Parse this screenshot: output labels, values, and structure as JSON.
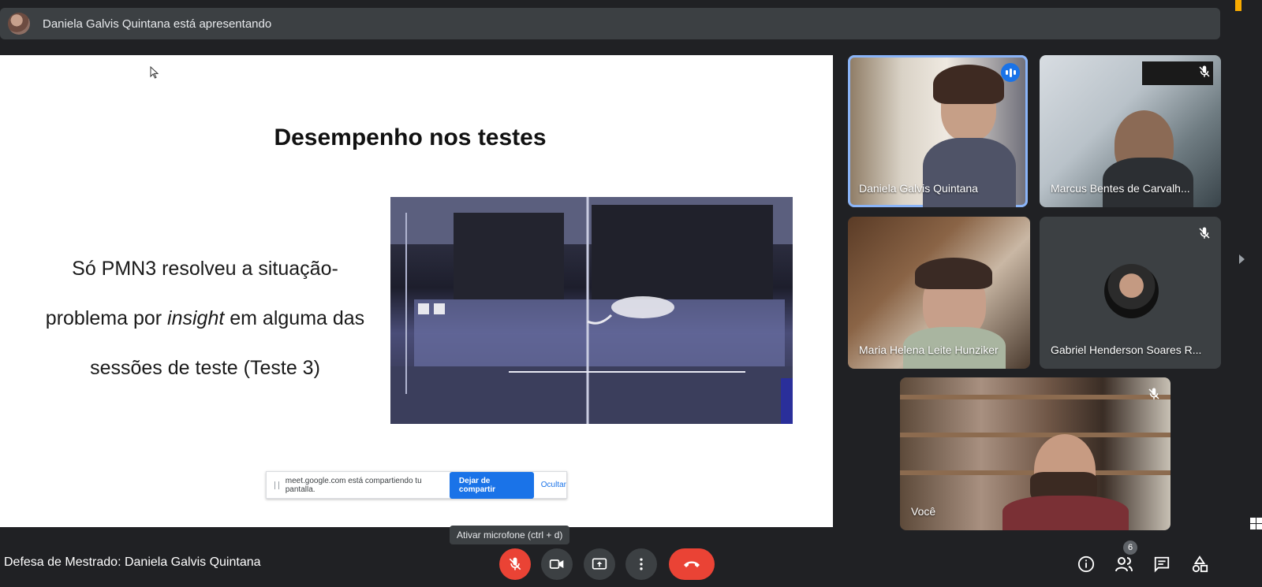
{
  "banner": {
    "presenting_text": "Daniela Galvis Quintana está apresentando",
    "avatar_icon": "presenter-avatar"
  },
  "slide": {
    "title": "Desempenho nos testes",
    "text_line1": "Só PMN3 resolveu a situação-",
    "text_line2_before": "problema por ",
    "text_line2_italic": "insight",
    "text_line2_after": " em alguma das",
    "text_line3": "sessões de teste (Teste 3)"
  },
  "share_bar": {
    "message": "meet.google.com está compartiendo tu pantalla.",
    "stop_label": "Dejar de compartir",
    "hide_label": "Ocultar"
  },
  "participants": [
    {
      "name": "Daniela Galvis Quintana",
      "state": "speaking"
    },
    {
      "name": "Marcus Bentes de Carvalh...",
      "state": "muted"
    },
    {
      "name": "Maria Helena Leite Hunziker",
      "state": "video"
    },
    {
      "name": "Gabriel Henderson Soares R...",
      "state": "muted"
    },
    {
      "name": "Você",
      "state": "muted"
    }
  ],
  "tooltip": "Ativar microfone (ctrl + d)",
  "meeting_title": "Defesa de Mestrado: Daniela Galvis Quintana",
  "participant_count": "6",
  "colors": {
    "accent": "#1a73e8",
    "danger": "#ea4335",
    "surface": "#3c4043",
    "background": "#202124"
  }
}
